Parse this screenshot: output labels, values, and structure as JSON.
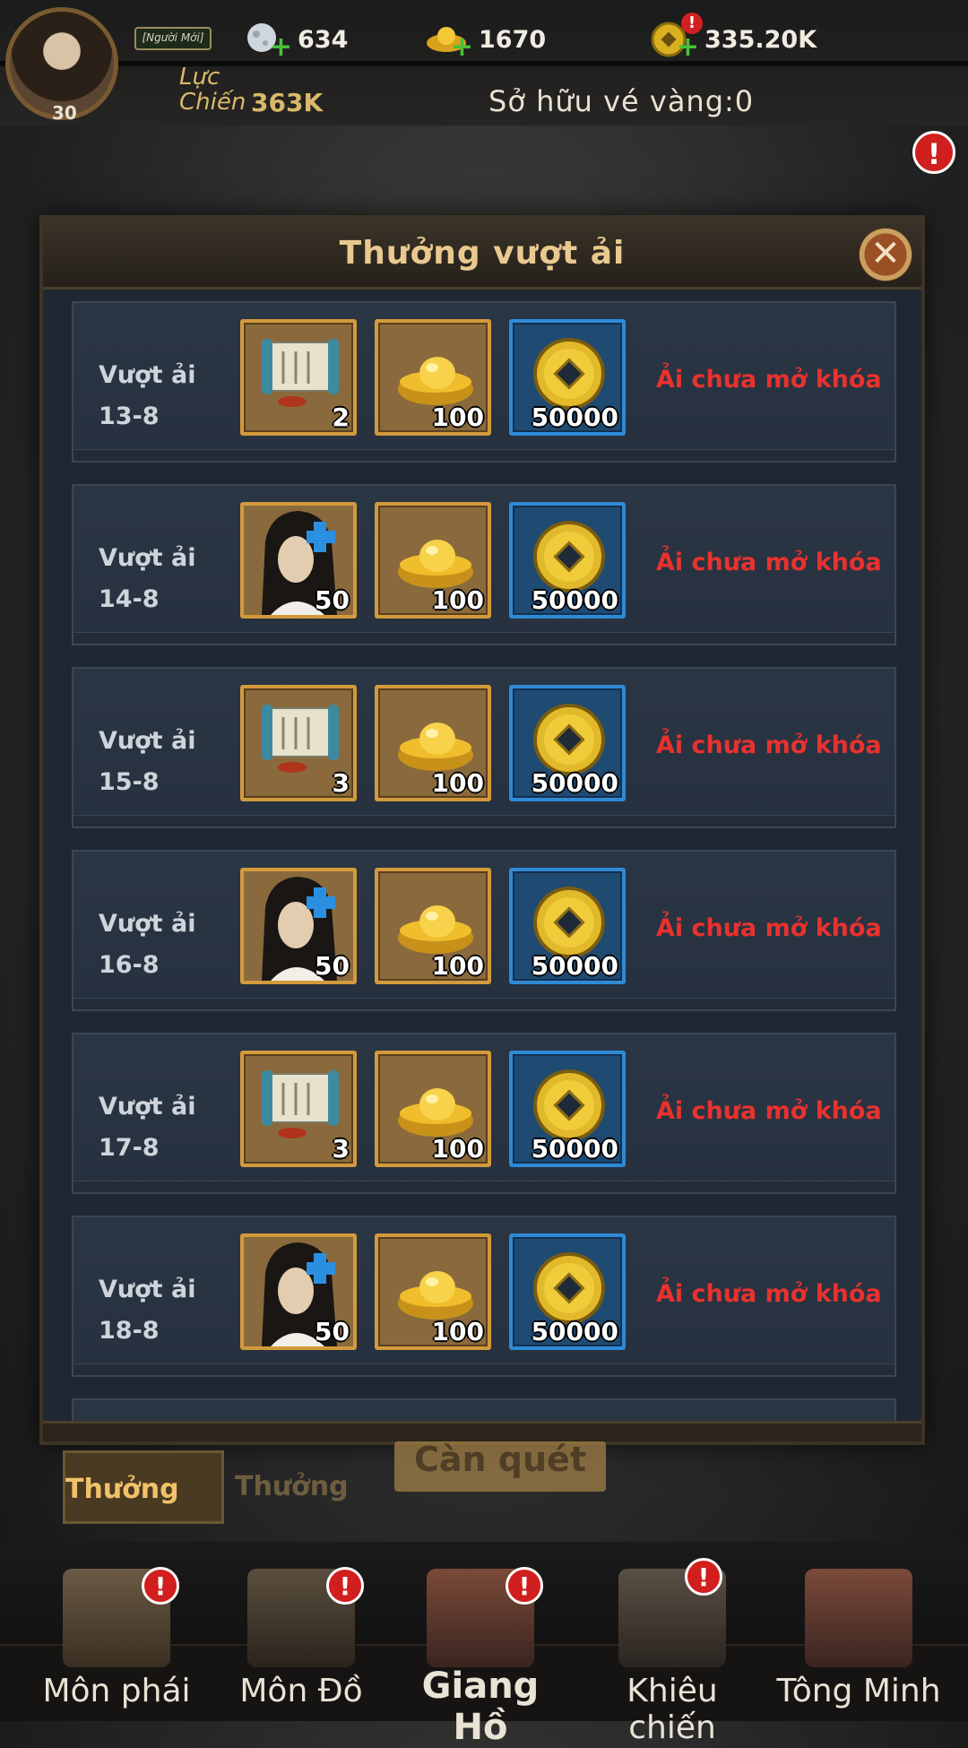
{
  "header": {
    "avatar_level": "30",
    "newbie_tag": "[Người Mới]",
    "resources": [
      {
        "icon": "jade-moon-icon",
        "value": "634"
      },
      {
        "icon": "gold-ingot-icon",
        "value": "1670"
      },
      {
        "icon": "coin-icon",
        "value": "335.20K"
      }
    ],
    "power_label": "Lực Chiến",
    "power_value": "363K",
    "ticket_text": "Sở hữu vé vàng:0"
  },
  "modal": {
    "title": "Thưởng vượt ải",
    "close_icon": "close-icon",
    "rows": [
      {
        "label_line1": "Vượt ải",
        "label_line2": "13-8",
        "rewards": [
          {
            "type": "scroll",
            "qty": "2"
          },
          {
            "type": "ingot",
            "qty": "100"
          },
          {
            "type": "coin",
            "qty": "50000"
          }
        ],
        "status": "Ải chưa mở khóa"
      },
      {
        "label_line1": "Vượt ải",
        "label_line2": "14-8",
        "rewards": [
          {
            "type": "hero",
            "qty": "50"
          },
          {
            "type": "ingot",
            "qty": "100"
          },
          {
            "type": "coin",
            "qty": "50000"
          }
        ],
        "status": "Ải chưa mở khóa"
      },
      {
        "label_line1": "Vượt ải",
        "label_line2": "15-8",
        "rewards": [
          {
            "type": "scroll",
            "qty": "3"
          },
          {
            "type": "ingot",
            "qty": "100"
          },
          {
            "type": "coin",
            "qty": "50000"
          }
        ],
        "status": "Ải chưa mở khóa"
      },
      {
        "label_line1": "Vượt ải",
        "label_line2": "16-8",
        "rewards": [
          {
            "type": "hero",
            "qty": "50"
          },
          {
            "type": "ingot",
            "qty": "100"
          },
          {
            "type": "coin",
            "qty": "50000"
          }
        ],
        "status": "Ải chưa mở khóa"
      },
      {
        "label_line1": "Vượt ải",
        "label_line2": "17-8",
        "rewards": [
          {
            "type": "scroll",
            "qty": "3"
          },
          {
            "type": "ingot",
            "qty": "100"
          },
          {
            "type": "coin",
            "qty": "50000"
          }
        ],
        "status": "Ải chưa mở khóa"
      },
      {
        "label_line1": "Vượt ải",
        "label_line2": "18-8",
        "rewards": [
          {
            "type": "hero",
            "qty": "50"
          },
          {
            "type": "ingot",
            "qty": "100"
          },
          {
            "type": "coin",
            "qty": "50000"
          }
        ],
        "status": "Ải chưa mở khóa"
      }
    ]
  },
  "tabs": [
    {
      "label": "Thưởng vượt",
      "active": true
    },
    {
      "label": "Thưởng càn qu",
      "active": false
    }
  ],
  "sweep_button": "Càn quét",
  "bottom_nav": [
    {
      "label": "Môn phái",
      "alert": true
    },
    {
      "label": "Môn Đồ",
      "alert": true
    },
    {
      "label": "Giang Hồ",
      "alert": true,
      "active": true
    },
    {
      "label": "Khiêu chiến",
      "alert": true
    },
    {
      "label": "Tông Minh",
      "alert": false
    }
  ],
  "alert_mark": "!",
  "colors": {
    "accent_gold": "#e9c98f",
    "status_red": "#e8322e",
    "panel": "#1f2733"
  }
}
